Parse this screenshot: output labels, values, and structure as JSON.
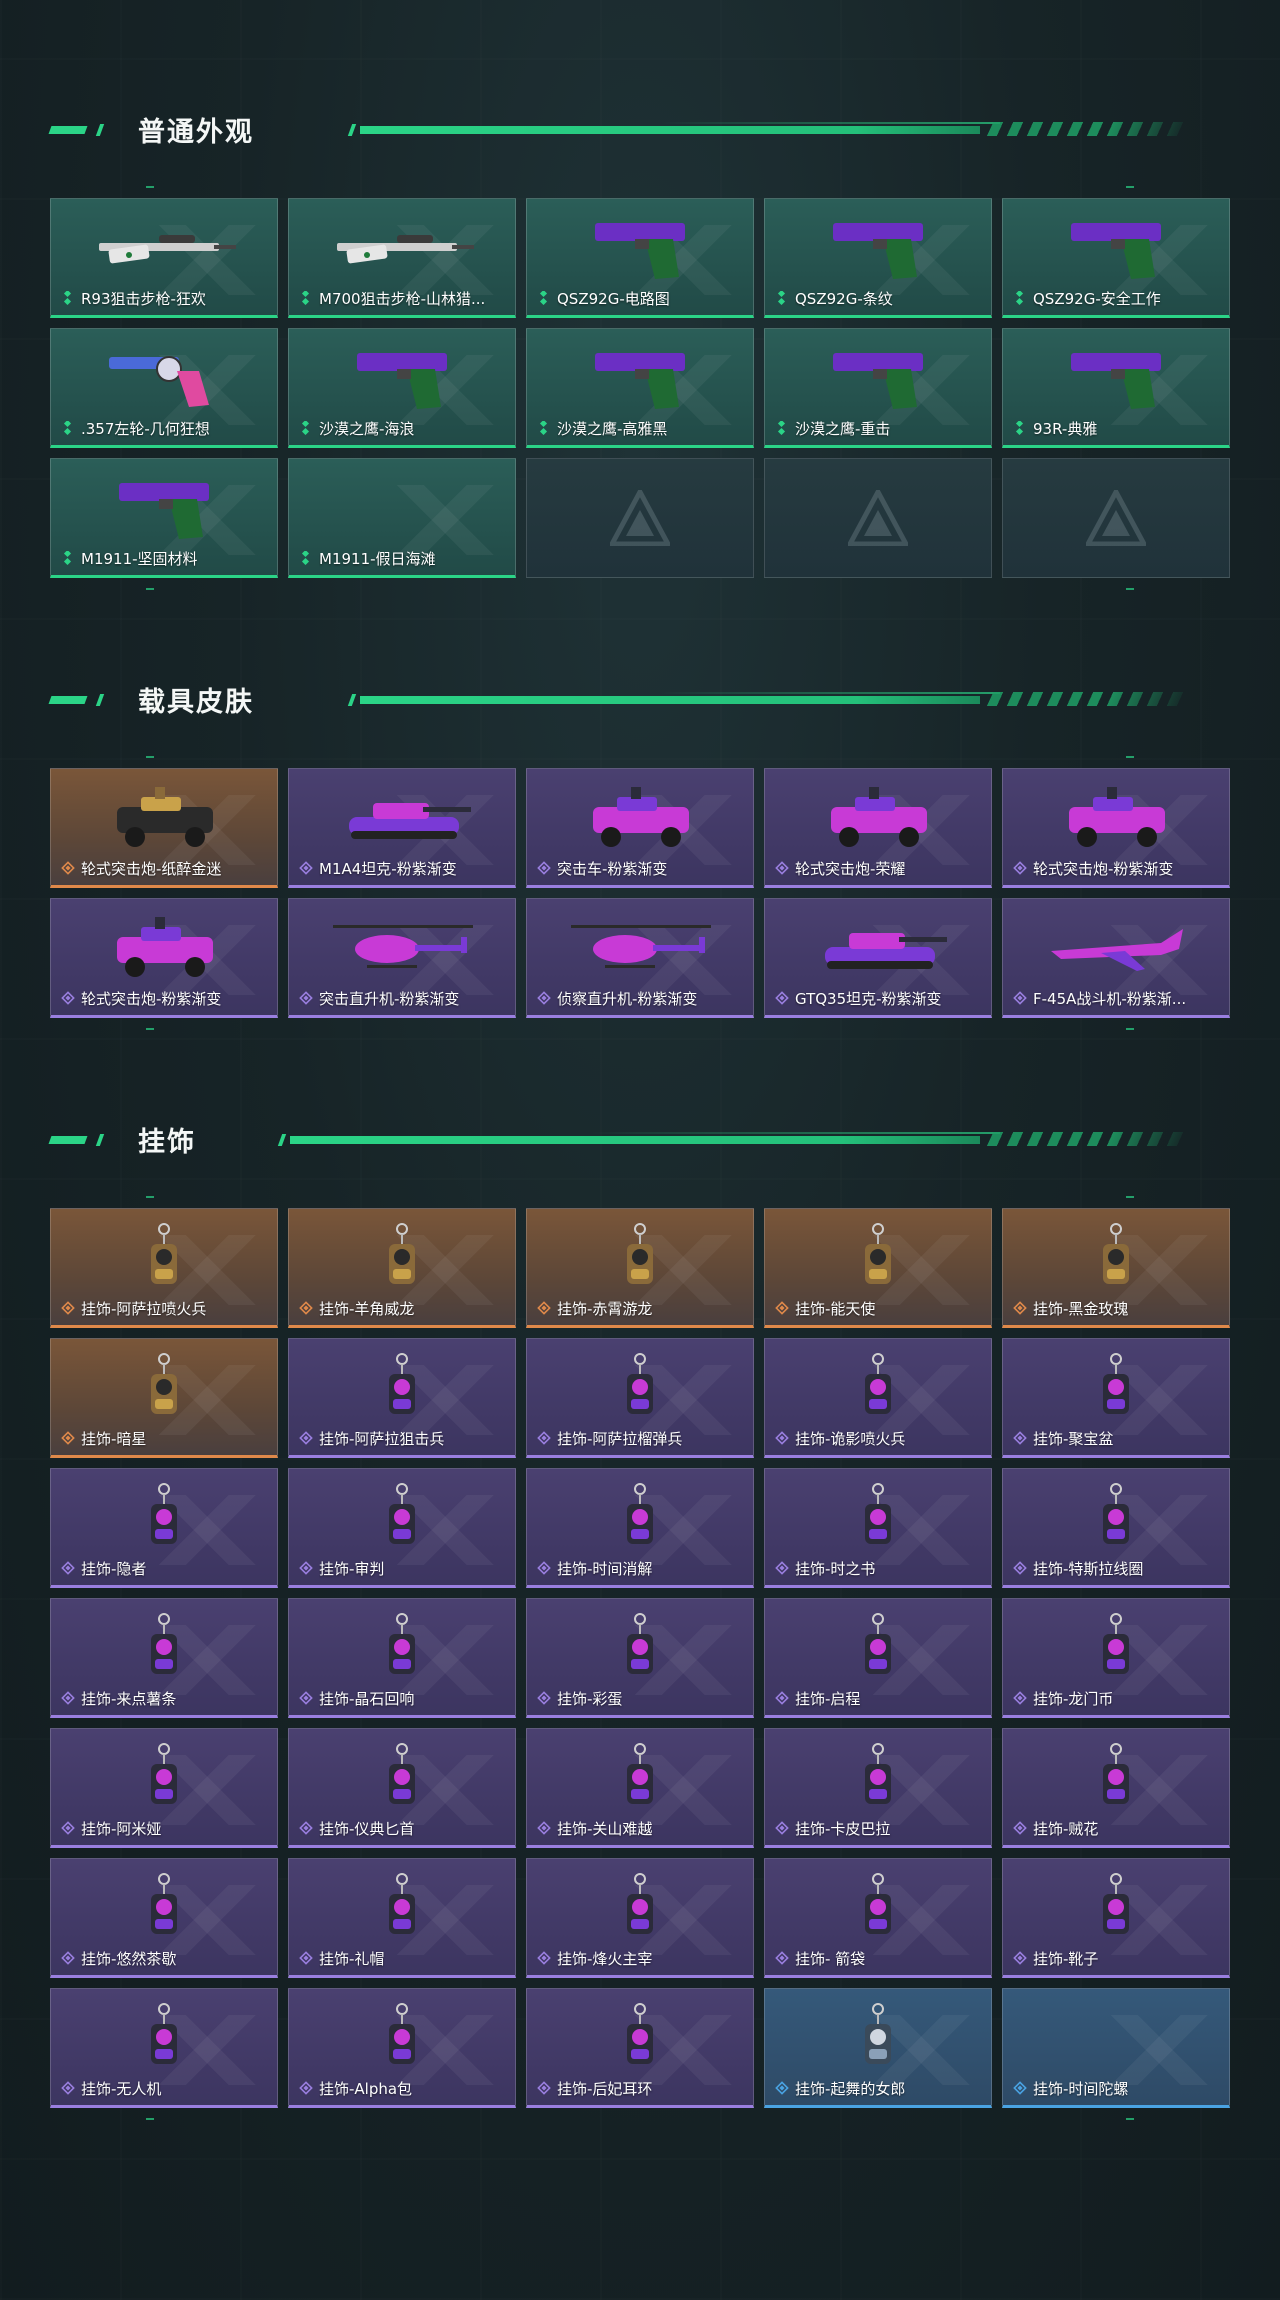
{
  "colors": {
    "accent": "#2bd487",
    "rarity_green": "#2bd487",
    "rarity_orange": "#e0894a",
    "rarity_purple": "#9a7fe0",
    "rarity_blue": "#4aa3e3"
  },
  "sections": [
    {
      "title": "普通外观",
      "items": [
        {
          "label": "R93狙击步枪-狂欢",
          "rarity": "green",
          "icon": "sniper-rifle-icon"
        },
        {
          "label": "M700狙击步枪-山林猎...",
          "rarity": "green",
          "icon": "sniper-rifle-icon"
        },
        {
          "label": "QSZ92G-电路图",
          "rarity": "green",
          "icon": "pistol-icon"
        },
        {
          "label": "QSZ92G-条纹",
          "rarity": "green",
          "icon": "pistol-icon"
        },
        {
          "label": "QSZ92G-安全工作",
          "rarity": "green",
          "icon": "pistol-icon"
        },
        {
          "label": ".357左轮-几何狂想",
          "rarity": "green",
          "icon": "revolver-icon"
        },
        {
          "label": "沙漠之鹰-海浪",
          "rarity": "green",
          "icon": "pistol-icon"
        },
        {
          "label": "沙漠之鹰-高雅黑",
          "rarity": "green",
          "icon": "pistol-icon"
        },
        {
          "label": "沙漠之鹰-重击",
          "rarity": "green",
          "icon": "pistol-icon"
        },
        {
          "label": "93R-典雅",
          "rarity": "green",
          "icon": "pistol-icon"
        },
        {
          "label": "M1911-坚固材料",
          "rarity": "green",
          "icon": "pistol-icon"
        },
        {
          "label": "M1911-假日海滩",
          "rarity": "green",
          "icon": ""
        },
        {
          "label": "",
          "rarity": "empty",
          "icon": ""
        },
        {
          "label": "",
          "rarity": "empty",
          "icon": ""
        },
        {
          "label": "",
          "rarity": "empty",
          "icon": ""
        }
      ]
    },
    {
      "title": "载具皮肤",
      "items": [
        {
          "label": "轮式突击炮-纸醉金迷",
          "rarity": "orange",
          "icon": "armored-car-icon"
        },
        {
          "label": "M1A4坦克-粉紫渐变",
          "rarity": "purple",
          "icon": "tank-icon"
        },
        {
          "label": "突击车-粉紫渐变",
          "rarity": "purple",
          "icon": "armored-car-icon"
        },
        {
          "label": "轮式突击炮-荣耀",
          "rarity": "purple",
          "icon": "armored-car-icon"
        },
        {
          "label": "轮式突击炮-粉紫渐变",
          "rarity": "purple",
          "icon": "armored-car-icon"
        },
        {
          "label": "轮式突击炮-粉紫渐变",
          "rarity": "purple",
          "icon": "armored-car-icon"
        },
        {
          "label": "突击直升机-粉紫渐变",
          "rarity": "purple",
          "icon": "helicopter-icon"
        },
        {
          "label": "侦察直升机-粉紫渐变",
          "rarity": "purple",
          "icon": "helicopter-icon"
        },
        {
          "label": "GTQ35坦克-粉紫渐变",
          "rarity": "purple",
          "icon": "tank-icon"
        },
        {
          "label": "F-45A战斗机-粉紫渐...",
          "rarity": "purple",
          "icon": "jet-icon"
        }
      ]
    },
    {
      "title": "挂饰",
      "items": [
        {
          "label": "挂饰-阿萨拉喷火兵",
          "rarity": "orange",
          "icon": "charm-icon"
        },
        {
          "label": "挂饰-羊角威龙",
          "rarity": "orange",
          "icon": "charm-icon"
        },
        {
          "label": "挂饰-赤霄游龙",
          "rarity": "orange",
          "icon": "charm-icon"
        },
        {
          "label": "挂饰-能天使",
          "rarity": "orange",
          "icon": "charm-icon"
        },
        {
          "label": "挂饰-黑金玫瑰",
          "rarity": "orange",
          "icon": "charm-icon"
        },
        {
          "label": "挂饰-暗星",
          "rarity": "orange",
          "icon": "charm-icon"
        },
        {
          "label": "挂饰-阿萨拉狙击兵",
          "rarity": "purple",
          "icon": "charm-icon"
        },
        {
          "label": "挂饰-阿萨拉榴弹兵",
          "rarity": "purple",
          "icon": "charm-icon"
        },
        {
          "label": "挂饰-诡影喷火兵",
          "rarity": "purple",
          "icon": "charm-icon"
        },
        {
          "label": "挂饰-聚宝盆",
          "rarity": "purple",
          "icon": "charm-icon"
        },
        {
          "label": "挂饰-隐者",
          "rarity": "purple",
          "icon": "charm-icon"
        },
        {
          "label": "挂饰-审判",
          "rarity": "purple",
          "icon": "charm-icon"
        },
        {
          "label": "挂饰-时间消解",
          "rarity": "purple",
          "icon": "charm-icon"
        },
        {
          "label": "挂饰-时之书",
          "rarity": "purple",
          "icon": "charm-icon"
        },
        {
          "label": "挂饰-特斯拉线圈",
          "rarity": "purple",
          "icon": "charm-icon"
        },
        {
          "label": "挂饰-来点薯条",
          "rarity": "purple",
          "icon": "charm-icon"
        },
        {
          "label": "挂饰-晶石回响",
          "rarity": "purple",
          "icon": "charm-icon"
        },
        {
          "label": "挂饰-彩蛋",
          "rarity": "purple",
          "icon": "charm-icon"
        },
        {
          "label": "挂饰-启程",
          "rarity": "purple",
          "icon": "charm-icon"
        },
        {
          "label": "挂饰-龙门币",
          "rarity": "purple",
          "icon": "charm-icon"
        },
        {
          "label": "挂饰-阿米娅",
          "rarity": "purple",
          "icon": "charm-icon"
        },
        {
          "label": "挂饰-仪典匕首",
          "rarity": "purple",
          "icon": "charm-icon"
        },
        {
          "label": "挂饰-关山难越",
          "rarity": "purple",
          "icon": "charm-icon"
        },
        {
          "label": "挂饰-卡皮巴拉",
          "rarity": "purple",
          "icon": "charm-icon"
        },
        {
          "label": "挂饰-贼花",
          "rarity": "purple",
          "icon": "charm-icon"
        },
        {
          "label": "挂饰-悠然茶歇",
          "rarity": "purple",
          "icon": "charm-icon"
        },
        {
          "label": "挂饰-礼帽",
          "rarity": "purple",
          "icon": "charm-icon"
        },
        {
          "label": "挂饰-烽火主宰",
          "rarity": "purple",
          "icon": "charm-icon"
        },
        {
          "label": "挂饰- 箭袋",
          "rarity": "purple",
          "icon": "charm-icon"
        },
        {
          "label": "挂饰-靴子",
          "rarity": "purple",
          "icon": "charm-icon"
        },
        {
          "label": "挂饰-无人机",
          "rarity": "purple",
          "icon": "charm-icon"
        },
        {
          "label": "挂饰-Alpha包",
          "rarity": "purple",
          "icon": "charm-icon"
        },
        {
          "label": "挂饰-后妃耳环",
          "rarity": "purple",
          "icon": "charm-icon"
        },
        {
          "label": "挂饰-起舞的女郎",
          "rarity": "blue",
          "icon": "charm-icon"
        },
        {
          "label": "挂饰-时间陀螺",
          "rarity": "blue",
          "icon": ""
        }
      ]
    }
  ]
}
